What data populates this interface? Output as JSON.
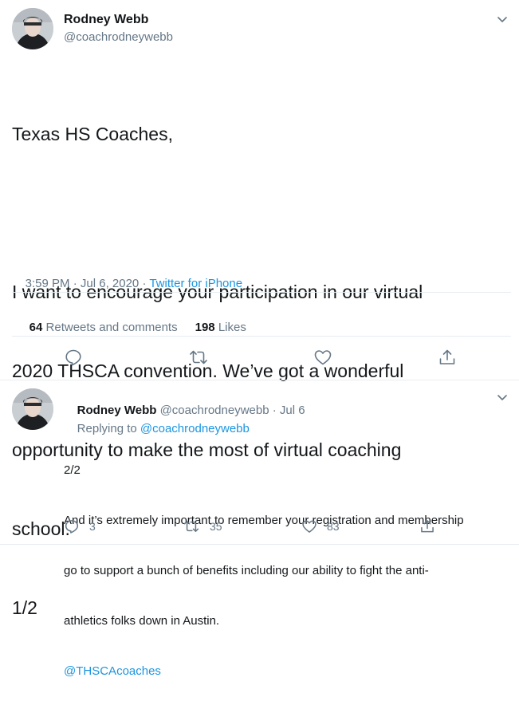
{
  "main_tweet": {
    "name": "Rodney Webb",
    "handle": "@coachrodneywebb",
    "text_lines": [
      "Texas HS Coaches,",
      "",
      "I want to encourage your participation in our virtual",
      "2020 THSCA convention. We’ve got a wonderful",
      "opportunity to make the most of virtual coaching",
      "school.",
      "1/2"
    ],
    "time": "3:59 PM",
    "sep1": " · ",
    "date": "Jul 6, 2020",
    "sep2": " · ",
    "source": "Twitter for iPhone",
    "retweets_count": "64",
    "retweets_label": "Retweets and comments",
    "likes_count": "198",
    "likes_label": "Likes"
  },
  "reply_tweet": {
    "name": "Rodney Webb",
    "handle": "@coachrodneywebb",
    "sep": " · ",
    "date": "Jul 6",
    "replying_label": "Replying to ",
    "replying_handle": "@coachrodneywebb",
    "text_lines": [
      "2/2",
      "And it’s extremely important to remember your registration and membership",
      "go to support a bunch of benefits including our ability to fight the anti-",
      "athletics folks down in Austin."
    ],
    "mention": "@THSCAcoaches",
    "reply_count": "3",
    "retweet_count": "35",
    "like_count": "83"
  },
  "icons": {
    "reply": "reply-icon",
    "retweet": "retweet-icon",
    "like": "heart-icon",
    "share": "share-icon",
    "more": "chevron-down-icon"
  },
  "colors": {
    "text": "#14171a",
    "muted": "#657786",
    "link": "#1b95e0",
    "divider": "#e6ecf0"
  }
}
